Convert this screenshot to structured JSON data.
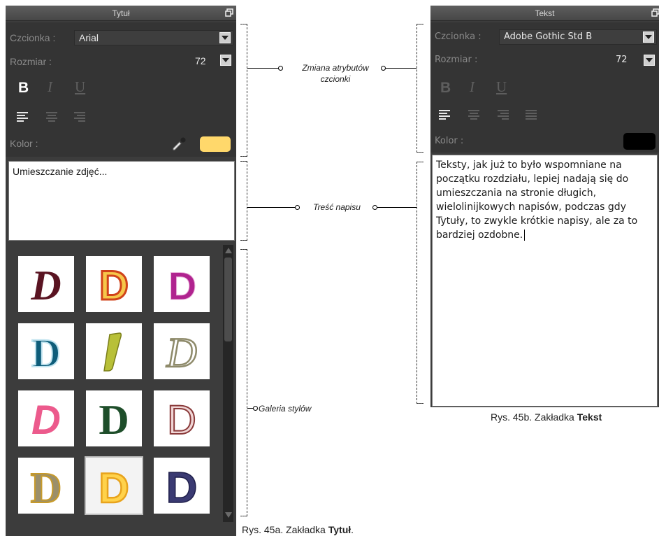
{
  "left_panel": {
    "title": "Tytuł",
    "font_label": "Czcionka :",
    "font_value": "Arial",
    "size_label": "Rozmiar :",
    "size_value": "72",
    "bold": "B",
    "italic": "I",
    "underline": "U",
    "color_label": "Kolor :",
    "color_swatch": "#ffd86b",
    "text_content": "Umieszczanie zdjęć...",
    "gallery_styles": [
      {
        "letter": "D",
        "style": "dark-red-italic"
      },
      {
        "letter": "D",
        "style": "orange-outline"
      },
      {
        "letter": "D",
        "style": "magenta-bold"
      },
      {
        "letter": "D",
        "style": "teal-serif"
      },
      {
        "letter": "D",
        "style": "olive-slant"
      },
      {
        "letter": "D",
        "style": "outline-italic"
      },
      {
        "letter": "D",
        "style": "pink-italic"
      },
      {
        "letter": "D",
        "style": "dark-green"
      },
      {
        "letter": "D",
        "style": "outline-maroon"
      },
      {
        "letter": "D",
        "style": "gold-outline"
      },
      {
        "letter": "D",
        "style": "yellow-embossed"
      },
      {
        "letter": "D",
        "style": "navy-bold"
      }
    ]
  },
  "right_panel": {
    "title": "Tekst",
    "font_label": "Czcionka :",
    "font_value": "Adobe Gothic Std B",
    "size_label": "Rozmiar :",
    "size_value": "72",
    "bold": "B",
    "italic": "I",
    "underline": "U",
    "color_label": "Kolor :",
    "color_swatch": "#000000",
    "text_content": "Teksty, jak już to było wspomniane na początku rozdziału, lepiej nadają się do umieszczania na stronie długich, wielolinijkowych napisów, podczas gdy Tytuły, to zwykle krótkie napisy, ale za to bardziej ozdobne."
  },
  "callouts": {
    "font_attrs": "Zmiana atrybutów czcionki",
    "text_content": "Treść napisu",
    "gallery": "Galeria stylów"
  },
  "captions": {
    "left_prefix": "Rys. 45a. Zakładka ",
    "left_bold": "Tytuł",
    "left_suffix": ".",
    "right_prefix": "Rys. 45b. Zakładka ",
    "right_bold": "Tekst"
  },
  "icons": {
    "restore": "restore-window-icon",
    "dropdown": "chevron-down-icon",
    "eyedropper": "eyedropper-icon"
  }
}
